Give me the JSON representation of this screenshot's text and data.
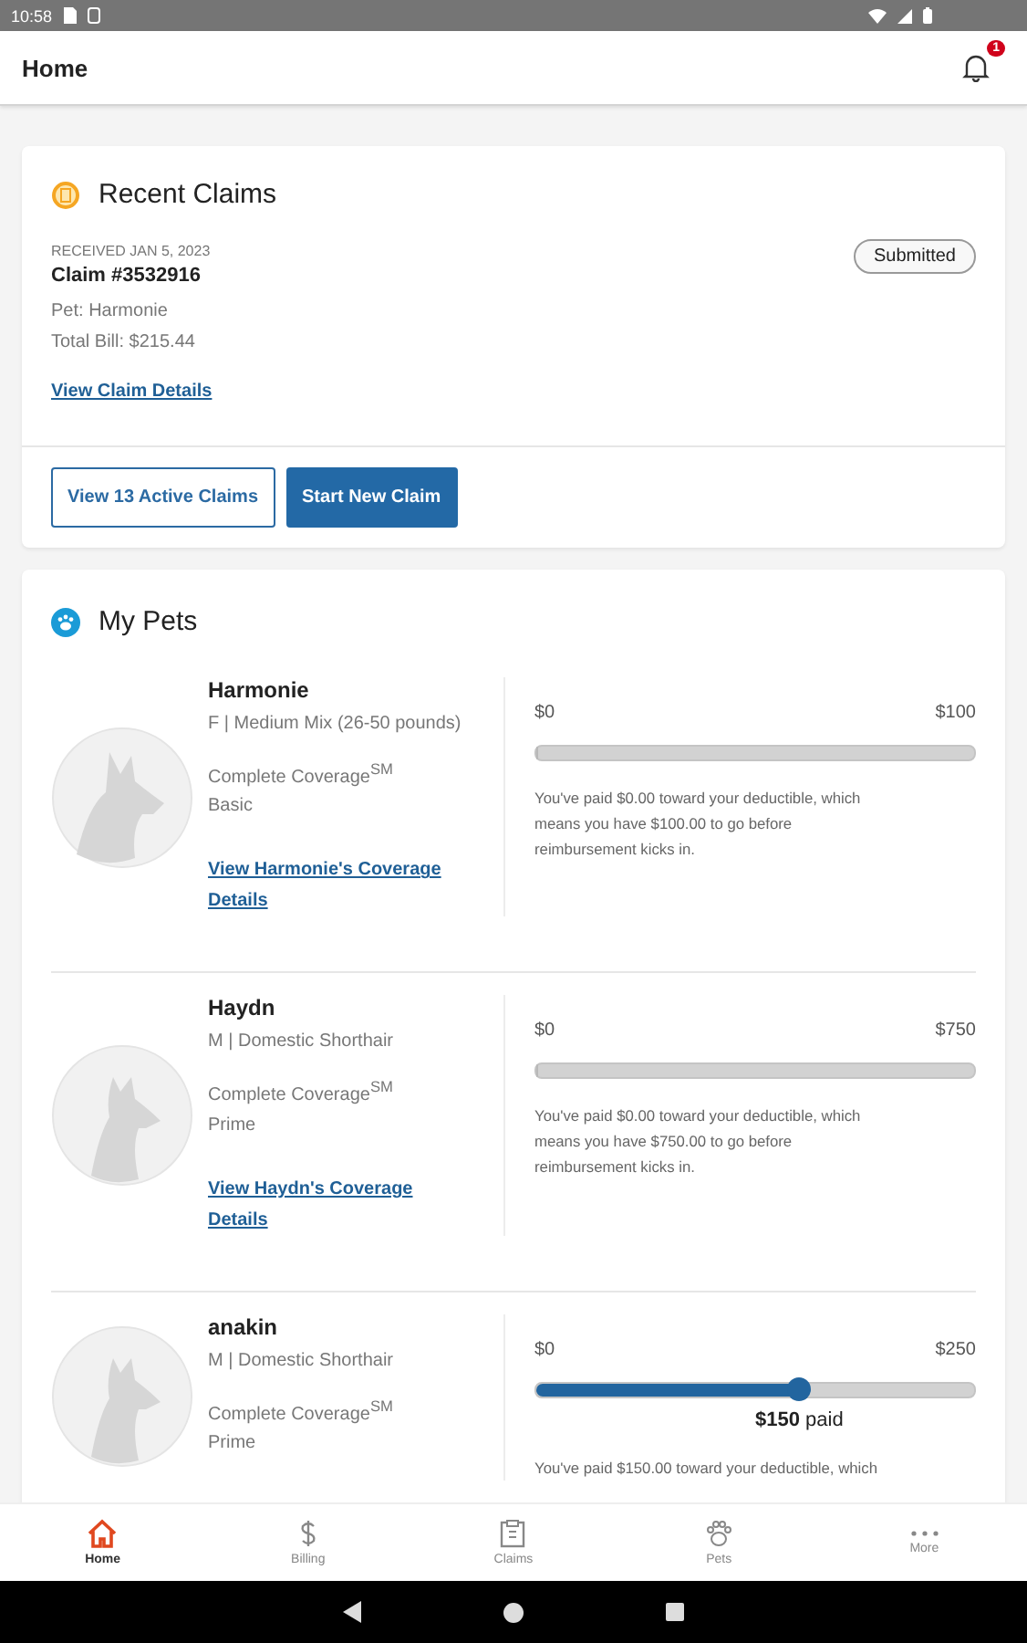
{
  "status_bar": {
    "time": "10:58"
  },
  "app_bar": {
    "title": "Home",
    "notification_count": "1"
  },
  "recent_claims": {
    "title": "Recent Claims",
    "received": "RECEIVED JAN 5, 2023",
    "claim_number": "Claim #3532916",
    "status": "Submitted",
    "pet": "Pet: Harmonie",
    "total_bill": "Total Bill: $215.44",
    "details_link": "View Claim Details",
    "buttons": [
      {
        "label": "View 13 Active Claims",
        "kind": "outline"
      },
      {
        "label": "Start New Claim",
        "kind": "filled"
      }
    ]
  },
  "my_pets": {
    "title": "My Pets",
    "pets": [
      {
        "name": "Harmonie",
        "kind": "dog",
        "details": "F | Medium Mix (26-50 pounds)",
        "plan": "Complete Coverage$^{SM}$",
        "tier": "Basic",
        "link": "View Harmonie's Coverage Details",
        "min": "$0",
        "max": "$100",
        "level": 0,
        "note": "You've paid $0.00 toward your deductible, which means you have $100.00 to go before reimbursement kicks in."
      },
      {
        "name": "Haydn",
        "kind": "cat",
        "details": "M | Domestic Shorthair",
        "plan": "Complete Coverage$^{SM}$",
        "tier": "Prime",
        "link": "View Haydn's Coverage Details",
        "min": "$0",
        "max": "$750",
        "level": 0,
        "note": "You've paid $0.00 toward your deductible, which means you have $750.00 to go before reimbursement kicks in."
      },
      {
        "name": "anakin",
        "kind": "cat",
        "details": "M | Domestic Shorthair",
        "plan": "Complete Coverage$^{SM}$",
        "tier": "Prime",
        "min": "$0",
        "max": "$250",
        "level": 0.6,
        "paid_label": "**$150** paid",
        "note": "You've paid $150.00 toward your deductible, which"
      }
    ]
  },
  "bottom_nav": [
    {
      "label": "Home",
      "kind": "home",
      "selected": true
    },
    {
      "label": "Billing",
      "kind": "billing",
      "selected": false
    },
    {
      "label": "Claims",
      "kind": "claims",
      "selected": false
    },
    {
      "label": "Pets",
      "kind": "pets",
      "selected": false
    },
    {
      "label": "More",
      "kind": "more",
      "selected": false
    }
  ]
}
